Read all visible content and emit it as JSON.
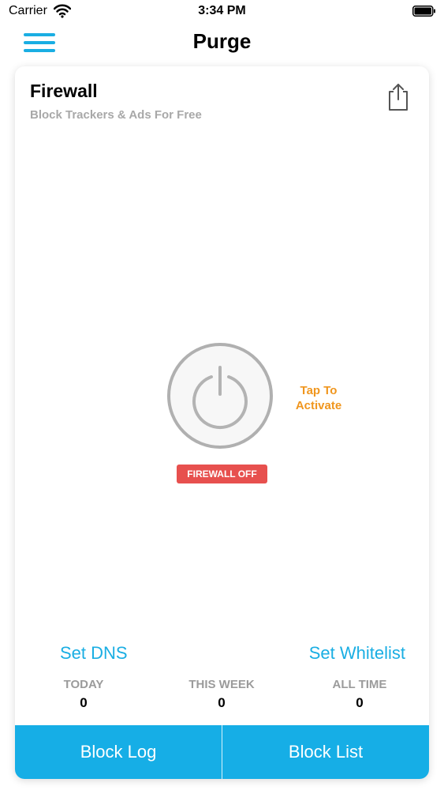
{
  "status_bar": {
    "carrier": "Carrier",
    "time": "3:34 PM"
  },
  "navbar": {
    "title": "Purge",
    "menu_icon": "hamburger-icon"
  },
  "card": {
    "title": "Firewall",
    "subtitle": "Block Trackers & Ads For Free",
    "share_icon": "share-icon",
    "power_icon": "power-icon",
    "tap_line1": "Tap To",
    "tap_line2": "Activate",
    "status_badge": "FIREWALL OFF",
    "set_dns": "Set DNS",
    "set_whitelist": "Set Whitelist",
    "stats": [
      {
        "label": "TODAY",
        "value": "0"
      },
      {
        "label": "THIS WEEK",
        "value": "0"
      },
      {
        "label": "ALL TIME",
        "value": "0"
      }
    ],
    "bottom_buttons": {
      "block_log": "Block Log",
      "block_list": "Block List"
    }
  },
  "colors": {
    "accent": "#1aaee3",
    "bottom_bar": "#16aee6",
    "tap_text": "#f0961e",
    "badge_off": "#e7504e",
    "muted_text": "#a8a8a8"
  }
}
